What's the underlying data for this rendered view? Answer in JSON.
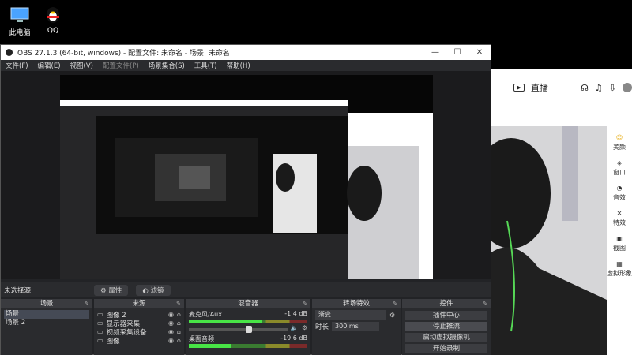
{
  "desktop": {
    "icons": [
      {
        "label": "此电脑",
        "icon": "computer-icon"
      },
      {
        "label": "QQ",
        "icon": "qq-penguin-icon"
      }
    ]
  },
  "live_app": {
    "live_label": "直播",
    "side_buttons": [
      "美颜",
      "窗口",
      "音效",
      "特效",
      "截图",
      "虚拟形象"
    ]
  },
  "obs": {
    "window_title": "OBS 27.1.3 (64-bit, windows) - 配置文件: 未命名 - 场景: 未命名",
    "menu": [
      {
        "label": "文件(F)",
        "disabled": false
      },
      {
        "label": "编辑(E)",
        "disabled": false
      },
      {
        "label": "视图(V)",
        "disabled": false
      },
      {
        "label": "配置文件(P)",
        "disabled": true
      },
      {
        "label": "场景集合(S)",
        "disabled": false
      },
      {
        "label": "工具(T)",
        "disabled": false
      },
      {
        "label": "帮助(H)",
        "disabled": false
      }
    ],
    "source_bar": {
      "status": "未选择源",
      "properties": "属性",
      "filters": "滤镜"
    },
    "scenes": {
      "title": "场景",
      "items": [
        "场景",
        "场景 2"
      ],
      "selected": 0
    },
    "sources": {
      "title": "来源",
      "items": [
        "图像 2",
        "显示器采集",
        "视频采集设备",
        "图像"
      ]
    },
    "mixer": {
      "title": "混音器",
      "channels": [
        {
          "name": "麦克风/Aux",
          "db": "-1.4 dB",
          "level": 0.62
        },
        {
          "name": "桌面音频",
          "db": "-19.6 dB",
          "level": 0.35
        }
      ]
    },
    "transitions": {
      "title": "转场特效",
      "type": "渐变",
      "duration_label": "时长",
      "duration_value": "300 ms"
    },
    "controls": {
      "title": "控件",
      "buttons": [
        "插件中心",
        "停止推流",
        "启动虚拟摄像机",
        "开始录制"
      ]
    }
  }
}
